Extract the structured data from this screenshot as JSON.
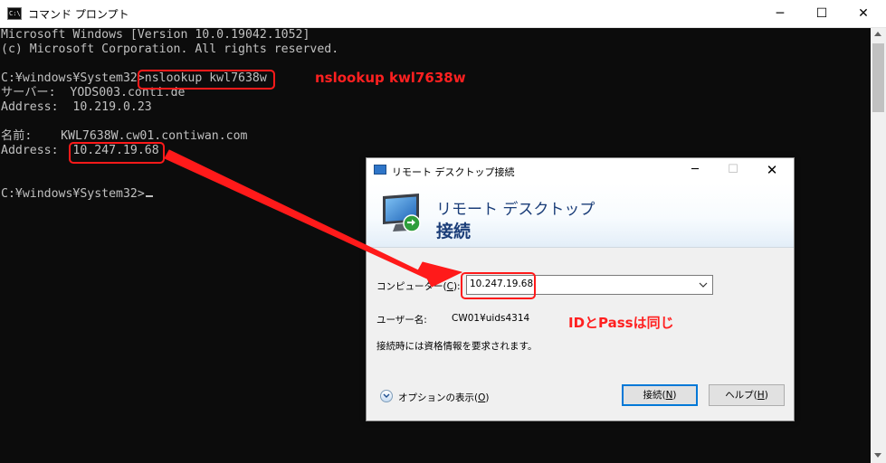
{
  "cmd": {
    "title": "コマンド プロンプト",
    "icon_text": "C:\\",
    "controls": {
      "minimize": "─",
      "maximize": "☐",
      "close": "✕"
    },
    "lines": [
      "Microsoft Windows [Version 10.0.19042.1052]",
      "(c) Microsoft Corporation. All rights reserved.",
      "",
      "C:¥windows¥System32>nslookup kwl7638w",
      "サーバー:  YODS003.conti.de",
      "Address:  10.219.0.23",
      "",
      "名前:    KWL7638W.cw01.contiwan.com",
      "Address:  10.247.19.68",
      "",
      "C:¥windows¥System32>"
    ]
  },
  "annotations": {
    "command_note": "nslookup kwl7638w",
    "credentials_note": "IDとPassは同じ",
    "color": "#ff1a1a"
  },
  "rdp": {
    "title": "リモート デスクトップ接続",
    "controls": {
      "minimize": "─",
      "maximize": "☐",
      "close": "✕"
    },
    "header_line1": "リモート デスクトップ",
    "header_line2": "接続",
    "computer_label": "コンピューター(",
    "computer_label_key": "C",
    "computer_label_end": "):",
    "computer_value": "10.247.19.68",
    "username_label": "ユーザー名:",
    "username_value": "CW01¥uids4314",
    "credential_notice": "接続時には資格情報を要求されます。",
    "options_label": "オプションの表示(",
    "options_key": "O",
    "options_end": ")",
    "connect_label": "接続(",
    "connect_key": "N",
    "connect_end": ")",
    "help_label": "ヘルプ(",
    "help_key": "H",
    "help_end": ")"
  }
}
